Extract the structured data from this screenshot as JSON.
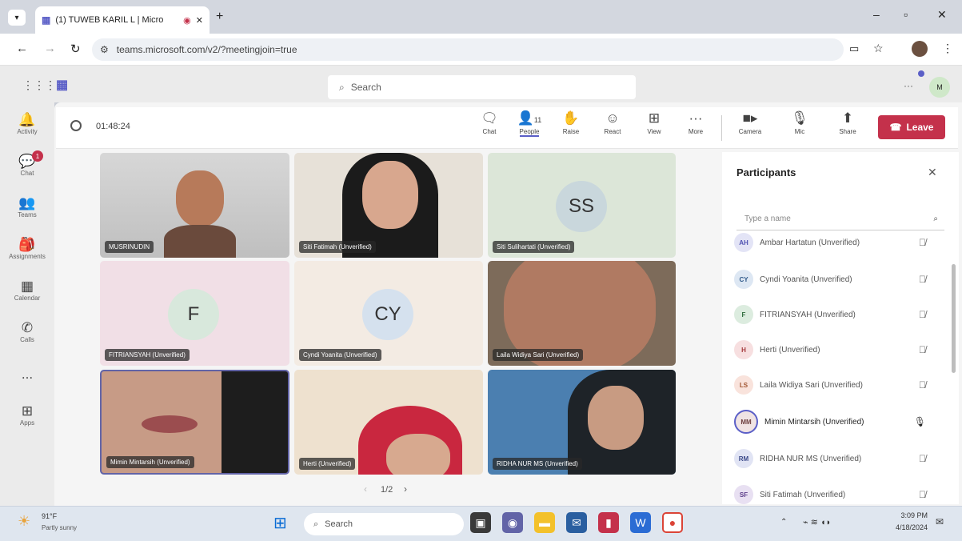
{
  "browser": {
    "tab_title": "(1) TUWEB KARIL L | Micro",
    "url": "teams.microsoft.com/v2/?meetingjoin=true"
  },
  "teams": {
    "search_placeholder": "Search",
    "rail": [
      {
        "label": "Activity",
        "icon": "bell-icon"
      },
      {
        "label": "Chat",
        "icon": "chat-icon",
        "badge": "1"
      },
      {
        "label": "Teams",
        "icon": "teams-icon"
      },
      {
        "label": "Assignments",
        "icon": "assignments-icon"
      },
      {
        "label": "Calendar",
        "icon": "calendar-icon"
      },
      {
        "label": "Calls",
        "icon": "calls-icon"
      },
      {
        "label": "...",
        "icon": "more-icon"
      },
      {
        "label": "Apps",
        "icon": "apps-icon"
      }
    ]
  },
  "meeting": {
    "timer": "01:48:24",
    "people_count": "11",
    "controls": {
      "chat": "Chat",
      "people": "People",
      "raise": "Raise",
      "react": "React",
      "view": "View",
      "more": "More",
      "camera": "Camera",
      "mic": "Mic",
      "share": "Share",
      "leave": "Leave"
    },
    "pager": "1/2"
  },
  "tiles": [
    {
      "name": "MUSRINUDIN",
      "initials": ""
    },
    {
      "name": "Siti Fatimah (Unverified)",
      "initials": ""
    },
    {
      "name": "Siti Sulihartati (Unverified)",
      "initials": "SS"
    },
    {
      "name": "FITRIANSYAH (Unverified)",
      "initials": "F"
    },
    {
      "name": "Cyndi Yoanita (Unverified)",
      "initials": "CY"
    },
    {
      "name": "Laila Widiya Sari (Unverified)",
      "initials": ""
    },
    {
      "name": "Mimin Mintarsih (Unverified)",
      "initials": ""
    },
    {
      "name": "Herti (Unverified)",
      "initials": ""
    },
    {
      "name": "RIDHA NUR MS (Unverified)",
      "initials": ""
    }
  ],
  "participants": {
    "title": "Participants",
    "search_placeholder": "Type a name",
    "list": [
      {
        "initials": "AH",
        "name": "Ambar Hartatun (Unverified)"
      },
      {
        "initials": "CY",
        "name": "Cyndi Yoanita (Unverified)"
      },
      {
        "initials": "F",
        "name": "FITRIANSYAH (Unverified)"
      },
      {
        "initials": "H",
        "name": "Herti (Unverified)"
      },
      {
        "initials": "LS",
        "name": "Laila Widiya Sari (Unverified)"
      },
      {
        "initials": "MM",
        "name": "Mimin Mintarsih (Unverified)"
      },
      {
        "initials": "RM",
        "name": "RIDHA NUR MS (Unverified)"
      },
      {
        "initials": "SF",
        "name": "Siti Fatimah (Unverified)"
      }
    ]
  },
  "taskbar": {
    "weather_temp": "91°F",
    "weather_desc": "Partly sunny",
    "search": "Search",
    "time": "3:09 PM",
    "date": "4/18/2024"
  }
}
